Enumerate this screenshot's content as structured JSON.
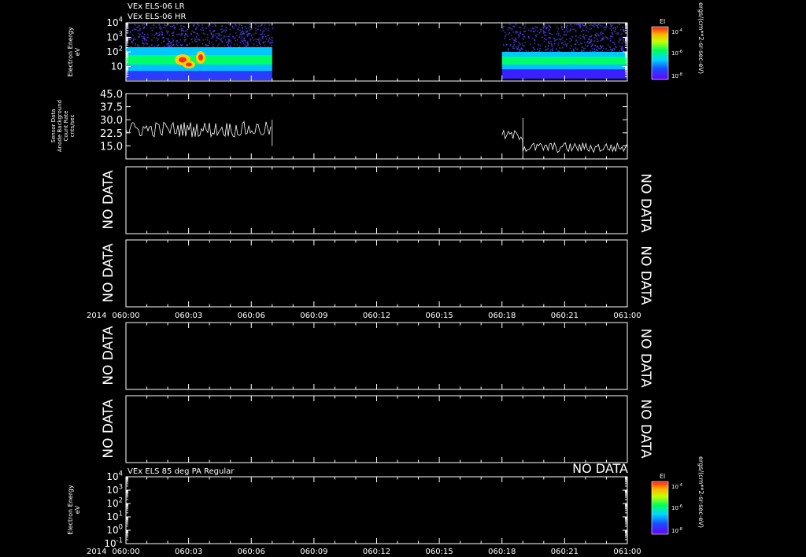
{
  "chart_data": [
    {
      "type": "heatmap",
      "title_lines": [
        "VEx ELS-06 LR",
        "VEx ELS-06 HR"
      ],
      "ylabel_lines": [
        "Electron Energy",
        "eV"
      ],
      "y_log": true,
      "ylim": [
        1,
        10000
      ],
      "yticks": [
        {
          "value": 10,
          "label": "10",
          "exp": ""
        },
        {
          "value": 100,
          "label": "10",
          "exp": "2"
        },
        {
          "value": 1000,
          "label": "10",
          "exp": "3"
        },
        {
          "value": 10000,
          "label": "10",
          "exp": "4"
        }
      ],
      "data_intervals": [
        [
          "060:00",
          "060:07"
        ],
        [
          "060:18",
          "061:00"
        ]
      ],
      "colorbar": {
        "label": "El",
        "unit_label": "ergs/(cm**2-sr-sec-eV)",
        "ticks": [
          {
            "label": "10",
            "exp": "-4"
          },
          {
            "label": "10",
            "exp": "-6"
          },
          {
            "label": "10",
            "exp": "-8"
          }
        ]
      }
    },
    {
      "type": "line",
      "ylabel_lines": [
        "Sensor Data",
        "Anode Background",
        "Count Rate",
        "cnts/sec"
      ],
      "ylim": [
        7.5,
        45.0
      ],
      "yticks": [
        "45.0",
        "37.5",
        "30.0",
        "22.5",
        "15.0"
      ],
      "segments": [
        {
          "start": "060:00",
          "end": "060:07",
          "level": 24.5,
          "noise": 4.5
        },
        {
          "start": "060:18",
          "end": "060:19",
          "level": 21.0,
          "noise": 3.0
        },
        {
          "start": "060:19",
          "end": "061:00",
          "level": 14.0,
          "noise": 3.0
        }
      ]
    },
    {
      "type": "empty",
      "left_label": "NO DATA",
      "right_label": "NO DATA"
    },
    {
      "type": "empty",
      "left_label": "NO DATA",
      "right_label": "NO DATA"
    },
    {
      "type": "empty",
      "left_label": "NO DATA",
      "right_label": "NO DATA"
    },
    {
      "type": "empty",
      "left_label": "NO DATA",
      "right_label": "NO DATA"
    },
    {
      "type": "heatmap",
      "title": "VEx ELS 85 deg PA Regular",
      "status_label": "NO DATA",
      "ylabel_lines": [
        "Electron Energy",
        "eV"
      ],
      "y_log": true,
      "ylim": [
        0.1,
        10000
      ],
      "yticks": [
        {
          "value": 0.1,
          "label": "10",
          "exp": "-1"
        },
        {
          "value": 1,
          "label": "10",
          "exp": "0"
        },
        {
          "value": 10,
          "label": "10",
          "exp": "1"
        },
        {
          "value": 100,
          "label": "10",
          "exp": "2"
        },
        {
          "value": 1000,
          "label": "10",
          "exp": "3"
        },
        {
          "value": 10000,
          "label": "10",
          "exp": "4"
        }
      ],
      "colorbar": {
        "label": "El",
        "unit_label": "ergs/(cm**2-sr-sec-eV)",
        "ticks": [
          {
            "label": "10",
            "exp": "-4"
          },
          {
            "label": "10",
            "exp": "-6"
          },
          {
            "label": "10",
            "exp": "-8"
          }
        ]
      }
    }
  ],
  "time_axis": {
    "year": "2014",
    "ticks": [
      "060:00",
      "060:03",
      "060:06",
      "060:09",
      "060:12",
      "060:15",
      "060:18",
      "060:21",
      "061:00"
    ]
  }
}
